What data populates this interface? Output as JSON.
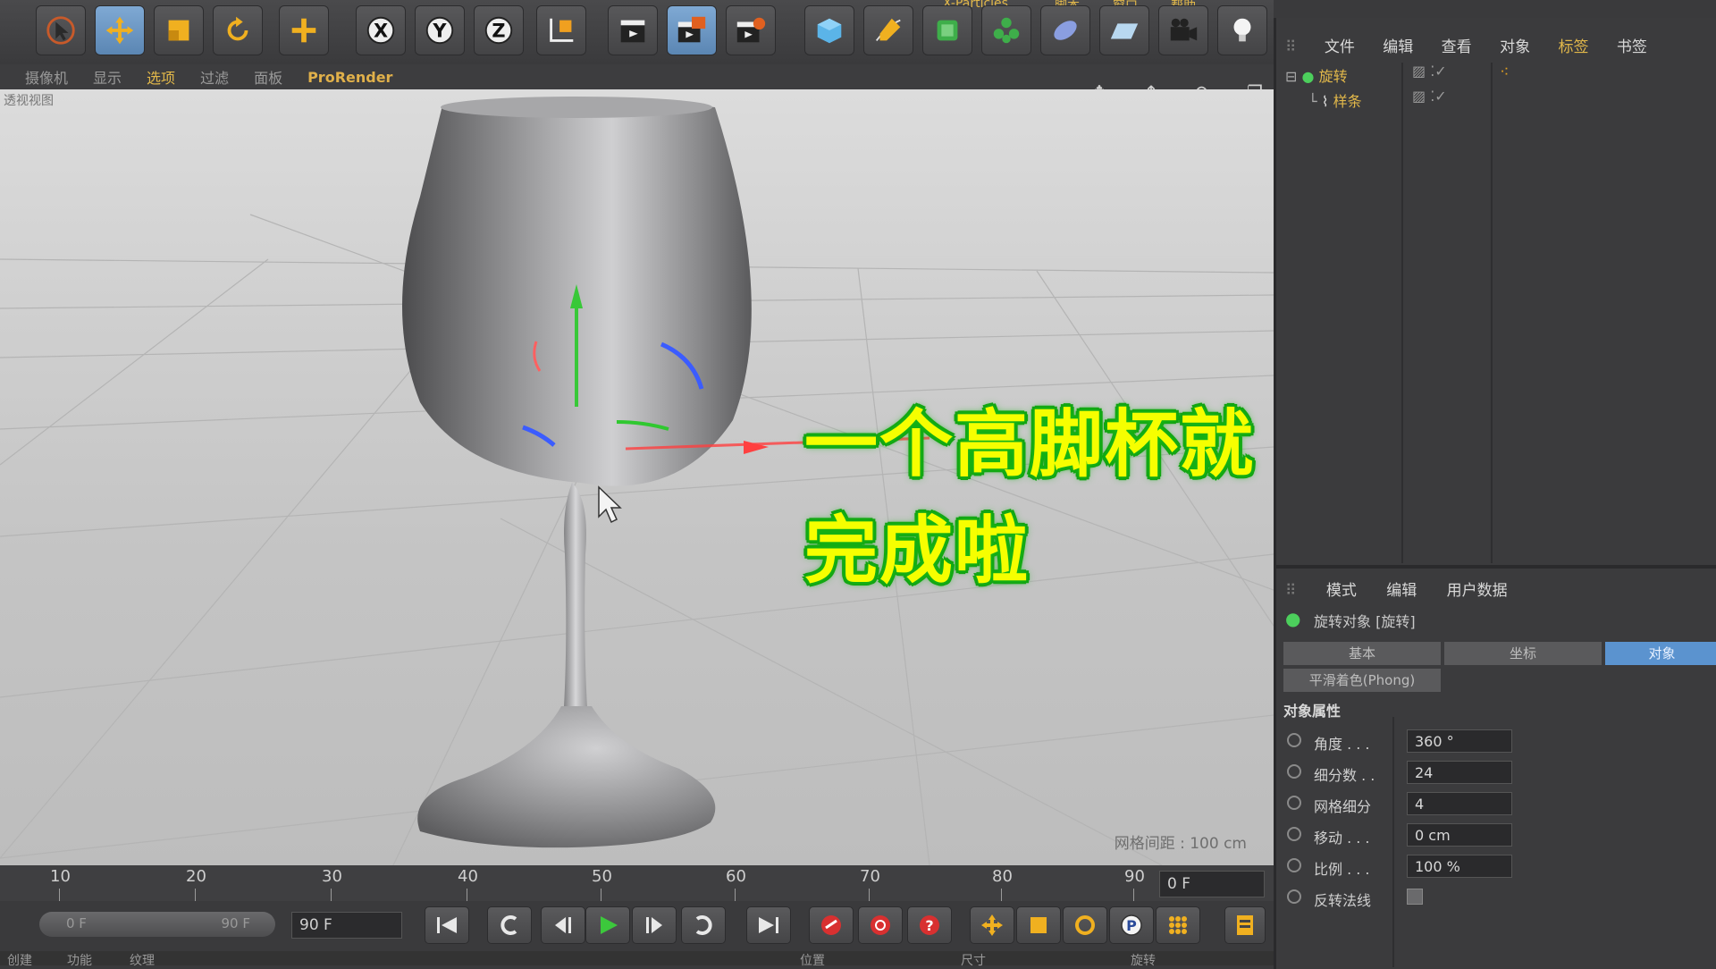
{
  "top_menu": [
    "X-Particles",
    "脚本",
    "窗口",
    "帮助"
  ],
  "viewport_menu": [
    "摄像机",
    "显示",
    "选项",
    "过滤",
    "面板",
    "ProRender"
  ],
  "viewport_label": "透视视图",
  "grid_spacing": "网格间距 : 100 cm",
  "caption": "一个高脚杯就完成啦",
  "timeline": {
    "ticks": [
      "10",
      "20",
      "30",
      "40",
      "50",
      "60",
      "70",
      "80",
      "90"
    ],
    "current_frame": "0 F"
  },
  "transport": {
    "range_start": "0 F",
    "range_end": "90 F",
    "end_field": "90 F"
  },
  "bottom_tabs": [
    "创建",
    "功能",
    "纹理",
    "位置",
    "尺寸",
    "旋转"
  ],
  "object_manager": {
    "menu": [
      "文件",
      "编辑",
      "查看",
      "对象",
      "标签",
      "书签"
    ],
    "objects": [
      {
        "name": "旋转"
      },
      {
        "name": "样条"
      }
    ]
  },
  "attribute_manager": {
    "menu": [
      "模式",
      "编辑",
      "用户数据"
    ],
    "title": "旋转对象 [旋转]",
    "tabs": [
      "基本",
      "坐标",
      "对象",
      "平滑着色(Phong)"
    ],
    "active_tab": "对象",
    "section": "对象属性",
    "properties": [
      {
        "label": "角度 . . .",
        "value": "360 °"
      },
      {
        "label": "细分数 . .",
        "value": "24"
      },
      {
        "label": "网格细分",
        "value": "4"
      },
      {
        "label": "移动 . . .",
        "value": "0 cm"
      },
      {
        "label": "比例 . . .",
        "value": "100 %"
      },
      {
        "label": "反转法线",
        "value": ""
      }
    ]
  },
  "colors": {
    "accent": "#e2b84a",
    "active_tab": "#5b93cf",
    "caption_text": "#f6ff00",
    "caption_outline": "#12a012"
  }
}
